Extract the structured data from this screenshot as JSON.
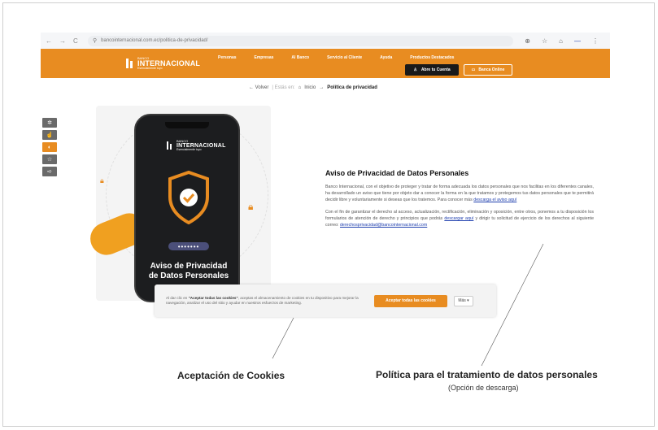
{
  "browser": {
    "nav": [
      "←",
      "→",
      "C"
    ],
    "url": "bancointernacional.com.ec/politica-de-privacidad/",
    "icons": [
      "zoom-icon",
      "star-icon",
      "extension-icon",
      "menu-icon"
    ]
  },
  "header": {
    "logo_small": "BANCO",
    "logo_name": "INTERNACIONAL",
    "logo_tag": "Esencialmente tuyo",
    "nav": [
      "Personas",
      "Empresas",
      "Al Banco",
      "Servicio al Cliente",
      "Ayuda",
      "Productos Destacados"
    ],
    "account_button": "Abre tu Cuenta",
    "online_button": "Banca Online"
  },
  "breadcrumb": {
    "back": "← Volver",
    "muted": "| Estás en:",
    "home": "Inicio",
    "arrow": "→",
    "current": "Política de privacidad"
  },
  "side_tools": [
    "accessibility-icon",
    "hand-icon",
    "contrast-icon",
    "star-icon",
    "share-icon"
  ],
  "phone": {
    "logo_name": "INTERNACIONAL",
    "logo_small": "BANCO",
    "logo_tag": "Esencialmente tuyo",
    "password_dots": "•••••••",
    "title_line1": "Aviso de Privacidad",
    "title_line2": "de Datos Personales"
  },
  "content": {
    "title": "Aviso de Privacidad de Datos Personales",
    "p1": "Banco Internacional, con el objetivo de proteger y tratar de forma adecuada los datos personales que nos facilitas en los diferentes canales, ha desarrollado un aviso que tiene por objeto dar a conocer la forma en la que tratamos y protegemos tus datos personales que te permitirá decidir libre y voluntariamente si deseas que los tratemos. Para conocer más",
    "p1_link": "descarga el aviso aquí",
    "p2": "Con el fin de garantizar el derecho al acceso, actualización, rectificación, eliminación y oposición, entre otros, ponemos a tu disposición los formularios de atención de derecho y principios que podrás",
    "p2_link": "descargar aquí",
    "p2_end": "y dirigir tu solicitud de ejercicio de los derechos al siguiente correo:",
    "email": "derechosprivacidad@bancointernacional.com"
  },
  "cookie": {
    "text_pre": "Al dar clic en",
    "text_bold": "\"Aceptar todas las cookies\"",
    "text_post": ", aceptas el almacenamiento de cookies en tu dispositivo para mejorar la navegación, analizar el uso del sitio y ayudar en nuestros esfuerzos de marketing.",
    "accept": "Aceptar todas las cookies",
    "more": "Más ▾"
  },
  "captions": {
    "left": "Aceptación de Cookies",
    "right": "Política para el tratamiento de datos personales",
    "right_sub": "(Opción de descarga)"
  },
  "colors": {
    "brand_orange": "#e88c21",
    "dark": "#1a1a1a",
    "link": "#1f3fae"
  }
}
